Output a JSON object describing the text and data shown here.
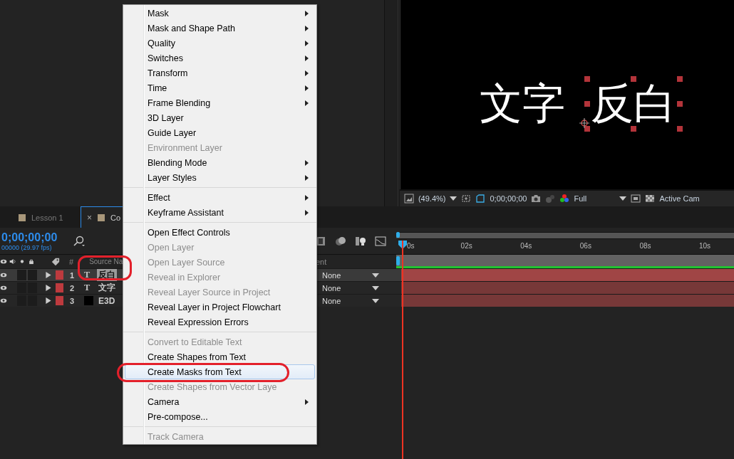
{
  "viewer": {
    "texts": [
      {
        "text": "文字",
        "selected": false
      },
      {
        "text": "反白",
        "selected": true
      }
    ],
    "toolbar": {
      "zoom": "(49.4%)",
      "timecode": "0;00;00;00",
      "resolution": "Full",
      "view": "Active Cam"
    }
  },
  "timeline": {
    "tabs": [
      {
        "label": "Lesson 1",
        "selected": false
      },
      {
        "label": "Co",
        "selected": true,
        "close": "×"
      }
    ],
    "timecode": "0;00;00;00",
    "fps": "00000 (29.97 fps)",
    "columns": {
      "number": "#",
      "source_name": "Source Na",
      "parent": "ent"
    },
    "ruler": [
      "0s",
      "02s",
      "04s",
      "06s",
      "08s",
      "10s"
    ],
    "layers": [
      {
        "number": "1",
        "kind": "text",
        "icon": "T",
        "name": "反白",
        "parent": "None",
        "selected": true
      },
      {
        "number": "2",
        "kind": "text",
        "icon": "T",
        "name": "文字",
        "parent": "None",
        "selected": false
      },
      {
        "number": "3",
        "kind": "solid",
        "name": "E3D",
        "parent": "None",
        "selected": false
      }
    ]
  },
  "context_menu": {
    "groups": [
      [
        {
          "label": "Mask",
          "disabled": false,
          "submenu": true,
          "selected": false
        },
        {
          "label": "Mask and Shape Path",
          "disabled": false,
          "submenu": true,
          "selected": false
        },
        {
          "label": "Quality",
          "disabled": false,
          "submenu": true,
          "selected": false
        },
        {
          "label": "Switches",
          "disabled": false,
          "submenu": true,
          "selected": false
        },
        {
          "label": "Transform",
          "disabled": false,
          "submenu": true,
          "selected": false
        },
        {
          "label": "Time",
          "disabled": false,
          "submenu": true,
          "selected": false
        },
        {
          "label": "Frame Blending",
          "disabled": false,
          "submenu": true,
          "selected": false
        },
        {
          "label": "3D Layer",
          "disabled": false,
          "submenu": false,
          "selected": false
        },
        {
          "label": "Guide Layer",
          "disabled": false,
          "submenu": false,
          "selected": false
        },
        {
          "label": "Environment Layer",
          "disabled": true,
          "submenu": false,
          "selected": false
        },
        {
          "label": "Blending Mode",
          "disabled": false,
          "submenu": true,
          "selected": false
        },
        {
          "label": "Layer Styles",
          "disabled": false,
          "submenu": true,
          "selected": false
        }
      ],
      [
        {
          "label": "Effect",
          "disabled": false,
          "submenu": true,
          "selected": false
        },
        {
          "label": "Keyframe Assistant",
          "disabled": false,
          "submenu": true,
          "selected": false
        }
      ],
      [
        {
          "label": "Open Effect Controls",
          "disabled": false,
          "submenu": false,
          "selected": false
        },
        {
          "label": "Open Layer",
          "disabled": true,
          "submenu": false,
          "selected": false
        },
        {
          "label": "Open Layer Source",
          "disabled": true,
          "submenu": false,
          "selected": false
        },
        {
          "label": "Reveal in Explorer",
          "disabled": true,
          "submenu": false,
          "selected": false
        },
        {
          "label": "Reveal Layer Source in Project",
          "disabled": true,
          "submenu": false,
          "selected": false
        },
        {
          "label": "Reveal Layer in Project Flowchart",
          "disabled": false,
          "submenu": false,
          "selected": false
        },
        {
          "label": "Reveal Expression Errors",
          "disabled": false,
          "submenu": false,
          "selected": false
        }
      ],
      [
        {
          "label": "Convert to Editable Text",
          "disabled": true,
          "submenu": false,
          "selected": false
        },
        {
          "label": "Create Shapes from Text",
          "disabled": false,
          "submenu": false,
          "selected": false
        },
        {
          "label": "Create Masks from Text",
          "disabled": false,
          "submenu": false,
          "selected": true
        },
        {
          "label": "Create Shapes from Vector Laye",
          "disabled": true,
          "submenu": false,
          "selected": false
        },
        {
          "label": "Camera",
          "disabled": false,
          "submenu": true,
          "selected": false
        },
        {
          "label": "Pre-compose...",
          "disabled": false,
          "submenu": false,
          "selected": false
        }
      ],
      [
        {
          "label": "Track Camera",
          "disabled": true,
          "submenu": false,
          "selected": false
        }
      ]
    ]
  }
}
